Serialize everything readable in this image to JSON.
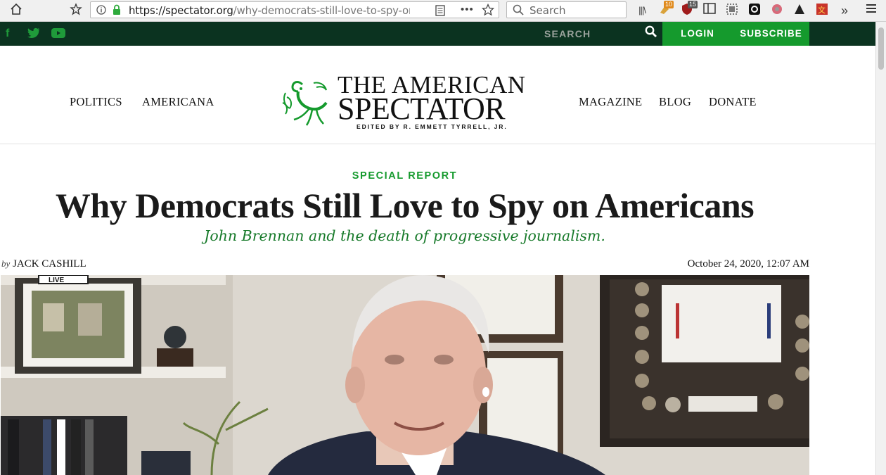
{
  "browser": {
    "url_host": "https://spectator.org",
    "url_path": "/why-democrats-still-love-to-spy-on-a",
    "search_placeholder": "Search",
    "badges": {
      "ext1": "10",
      "ext2": "15"
    }
  },
  "topbar": {
    "social": [
      "f",
      "t",
      "yt"
    ],
    "search_label": "SEARCH",
    "login_label": "LOGIN",
    "subscribe_label": "SUBSCRIBE"
  },
  "nav": {
    "left": [
      "POLITICS",
      "AMERICANA"
    ],
    "right": [
      "MAGAZINE",
      "BLOG",
      "DONATE"
    ]
  },
  "logo": {
    "line1": "THE AMERICAN",
    "line2": "SPECTATOR",
    "subtitle": "EDITED BY R. EMMETT TYRRELL, JR."
  },
  "article": {
    "kicker": "SPECIAL REPORT",
    "headline": "Why Democrats Still Love to Spy on Americans",
    "dek": "John Brennan and the death of progressive journalism.",
    "by_prefix": "by",
    "author": "JACK CASHILL",
    "date": "October 24, 2020, 12:07 AM",
    "hero_caption_tag": "LIVE"
  },
  "colors": {
    "brand_green": "#159a2d",
    "dark_strip": "#0b3320",
    "dek_green": "#177a2a"
  }
}
